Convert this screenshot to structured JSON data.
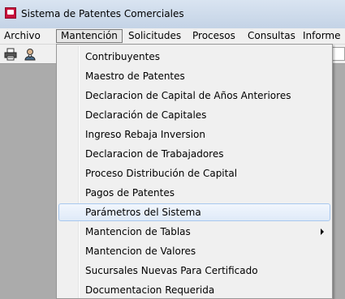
{
  "window": {
    "title": "Sistema de Patentes Comerciales"
  },
  "menubar": {
    "items": [
      "Archivo",
      "Mantención",
      "Solicitudes",
      "Procesos",
      "Consultas",
      "Informe"
    ]
  },
  "toolbar": {
    "buttons": [
      "print-icon",
      "user-icon"
    ]
  },
  "dropdown": {
    "items": [
      "Contribuyentes",
      "Maestro de Patentes",
      "Declaracion de Capital de Años Anteriores",
      "Declaración de Capitales",
      "Ingreso Rebaja Inversion",
      "Declaracion de Trabajadores",
      "Proceso Distribución de Capital",
      "Pagos de Patentes",
      "Parámetros del Sistema",
      "Mantencion de Tablas",
      "Mantencion de Valores",
      "Sucursales Nuevas Para Certificado",
      "Documentacion Requerida"
    ],
    "highlighted_item": "Parámetros del Sistema",
    "submenu_item": "Mantencion de Tablas"
  },
  "colors": {
    "workarea": "#ababab",
    "menu": "#f0f0f0",
    "highlight_border": "#a8c8ef"
  }
}
